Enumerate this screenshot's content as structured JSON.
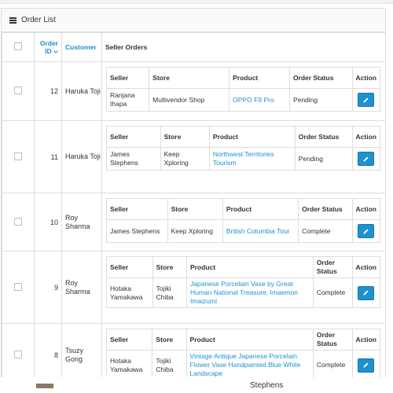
{
  "panel": {
    "title": "Order List"
  },
  "columns": {
    "order_id": "Order ID",
    "customer": "Customer",
    "seller_orders": "Seller Orders"
  },
  "sub_columns": {
    "seller": "Seller",
    "store": "Store",
    "product": "Product",
    "order_status": "Order Status",
    "action": "Action"
  },
  "orders": [
    {
      "id": "12",
      "customer": "Haruka Toji",
      "seller": "Ranjana thapa",
      "store": "Multivendor Shop",
      "product": "OPPO F9 Pro",
      "status": "Pending"
    },
    {
      "id": "11",
      "customer": "Haruka Toji",
      "seller": "James Stephens",
      "store": "Keep Xploring",
      "product": "Northwest Territories Tourism",
      "status": "Pending"
    },
    {
      "id": "10",
      "customer": "Roy Sharma",
      "seller": "James Stephens",
      "store": "Keep Xploring",
      "product": "British Columbia Tour",
      "status": "Complete"
    },
    {
      "id": "9",
      "customer": "Roy Sharma",
      "seller": "Hotaka Yamakawa",
      "store": "Tojiki Chiba",
      "product": "Japanese Porcelain Vase by Great Human National Treasure, Imaemon Imaizumi",
      "status": "Complete"
    },
    {
      "id": "8",
      "customer": "Tsuzy Gong",
      "seller": "Hotaka Yamakawa",
      "store": "Tojiki Chiba",
      "product": "Vintage Antique Japanese Porcelain Flower Vase Handpainted Blue White Landscape",
      "status": "Complete"
    }
  ],
  "footer": {
    "partial_text": "Stephens"
  },
  "icons": {
    "heading": "list-icon",
    "sort": "chevron-down-icon",
    "edit": "pencil-icon"
  },
  "colors": {
    "link": "#1e91cf",
    "button": "#1e91cf",
    "border": "#dddddd"
  }
}
